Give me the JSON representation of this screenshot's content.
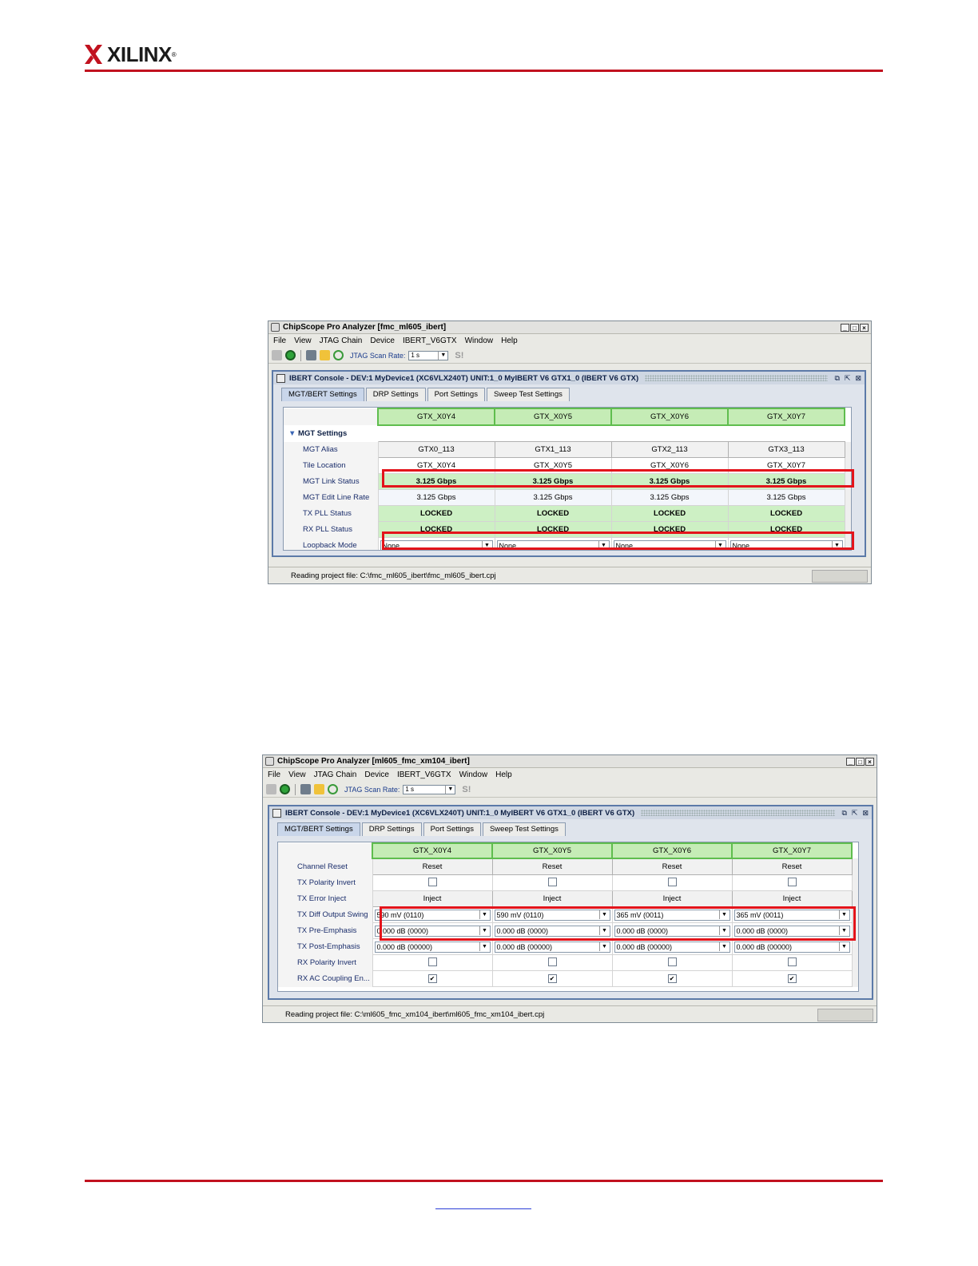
{
  "header": {
    "logo_text": "XILINX",
    "logo_reg": "®"
  },
  "brand": {
    "rule_color": "#c1121f",
    "header_green": "#5fbd4e",
    "highlight_red": "#e3141b"
  },
  "menu": [
    "File",
    "View",
    "JTAG Chain",
    "Device",
    "IBERT_V6GTX",
    "Window",
    "Help"
  ],
  "toolbar": {
    "scan_label": "JTAG Scan Rate:",
    "scan_value": "1 s",
    "s_label": "S!"
  },
  "tabs": [
    "MGT/BERT Settings",
    "DRP Settings",
    "Port Settings",
    "Sweep Test Settings"
  ],
  "columns": [
    "GTX_X0Y4",
    "GTX_X0Y5",
    "GTX_X0Y6",
    "GTX_X0Y7"
  ],
  "window1": {
    "title": "ChipScope Pro Analyzer [fmc_ml605_ibert]",
    "console_title": "IBERT Console - DEV:1 MyDevice1 (XC6VLX240T) UNIT:1_0 MyIBERT V6 GTX1_0 (IBERT V6 GTX)",
    "group_label": "MGT Settings",
    "rows": [
      {
        "label": "MGT Alias",
        "kind": "button",
        "values": [
          "GTX0_113",
          "GTX1_113",
          "GTX2_113",
          "GTX3_113"
        ]
      },
      {
        "label": "Tile Location",
        "kind": "text",
        "values": [
          "GTX_X0Y4",
          "GTX_X0Y5",
          "GTX_X0Y6",
          "GTX_X0Y7"
        ]
      },
      {
        "label": "MGT Link Status",
        "kind": "green",
        "values": [
          "3.125 Gbps",
          "3.125 Gbps",
          "3.125 Gbps",
          "3.125 Gbps"
        ]
      },
      {
        "label": "MGT Edit Line Rate",
        "kind": "edit",
        "values": [
          "3.125 Gbps",
          "3.125 Gbps",
          "3.125 Gbps",
          "3.125 Gbps"
        ]
      },
      {
        "label": "TX PLL Status",
        "kind": "green",
        "values": [
          "LOCKED",
          "LOCKED",
          "LOCKED",
          "LOCKED"
        ]
      },
      {
        "label": "RX PLL Status",
        "kind": "green",
        "values": [
          "LOCKED",
          "LOCKED",
          "LOCKED",
          "LOCKED"
        ]
      },
      {
        "label": "Loopback Mode",
        "kind": "dropdown",
        "values": [
          "None",
          "None",
          "None",
          "None"
        ]
      }
    ],
    "status": "Reading project file: C:\\fmc_ml605_ibert\\fmc_ml605_ibert.cpj"
  },
  "window2": {
    "title": "ChipScope Pro Analyzer [ml605_fmc_xm104_ibert]",
    "console_title": "IBERT Console - DEV:1 MyDevice1 (XC6VLX240T) UNIT:1_0 MyIBERT V6 GTX1_0 (IBERT V6 GTX)",
    "rows": [
      {
        "label": "Channel Reset",
        "kind": "button",
        "values": [
          "Reset",
          "Reset",
          "Reset",
          "Reset"
        ]
      },
      {
        "label": "TX Polarity Invert",
        "kind": "checkbox",
        "values": [
          "",
          "",
          "",
          ""
        ]
      },
      {
        "label": "TX Error Inject",
        "kind": "button",
        "values": [
          "Inject",
          "Inject",
          "Inject",
          "Inject"
        ]
      },
      {
        "label": "TX Diff Output Swing",
        "kind": "dropdown",
        "values": [
          "590 mV (0110)",
          "590 mV (0110)",
          "365 mV (0011)",
          "365 mV (0011)"
        ]
      },
      {
        "label": "TX Pre-Emphasis",
        "kind": "dropdown",
        "values": [
          "0.000 dB (0000)",
          "0.000 dB (0000)",
          "0.000 dB (0000)",
          "0.000 dB (0000)"
        ]
      },
      {
        "label": "TX Post-Emphasis",
        "kind": "dropdown",
        "values": [
          "0.000 dB (00000)",
          "0.000 dB (00000)",
          "0.000 dB (00000)",
          "0.000 dB (00000)"
        ]
      },
      {
        "label": "RX Polarity Invert",
        "kind": "checkbox",
        "values": [
          "",
          "",
          "",
          ""
        ]
      },
      {
        "label": "RX AC Coupling En...",
        "kind": "checkbox",
        "values": [
          "✔",
          "✔",
          "✔",
          "✔"
        ]
      }
    ],
    "status": "Reading project file: C:\\ml605_fmc_xm104_ibert\\ml605_fmc_xm104_ibert.cpj"
  }
}
